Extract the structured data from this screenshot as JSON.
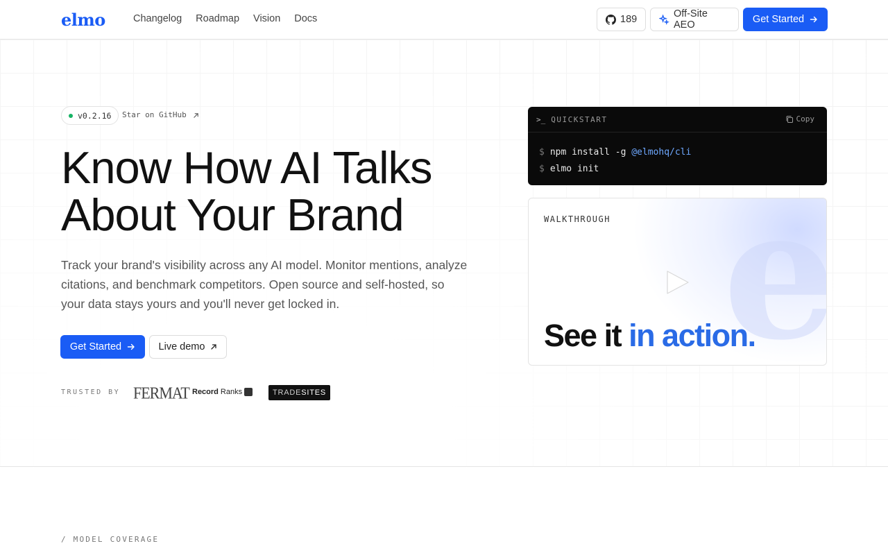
{
  "brand": {
    "logo": "elmo",
    "accent": "#1a5cf5"
  },
  "nav": {
    "items": [
      "Changelog",
      "Roadmap",
      "Vision",
      "Docs"
    ]
  },
  "header": {
    "github_count": "189",
    "github_icon": "github-icon",
    "aeo_label": "Off-Site AEO",
    "aeo_icon": "sparkle-icon",
    "cta_label": "Get Started",
    "cta_icon": "arrow-right-icon"
  },
  "hero": {
    "version": "v0.2.16",
    "star_link": "Star on GitHub",
    "title_line1": "Know How AI Talks",
    "title_line2": "About Your Brand",
    "lead": "Track your brand's visibility across any AI model. Monitor mentions, analyze citations, and benchmark competitors. Open source and self-hosted, so your data stays yours and you'll never get locked in.",
    "cta_primary": "Get Started",
    "cta_secondary": "Live demo"
  },
  "trusted": {
    "label": "TRUSTED BY",
    "logos": {
      "fermat": "FERMAT",
      "rr_bold": "Record",
      "rr_light": "Ranks",
      "trade_a": "TRADE",
      "trade_b": "SITES"
    }
  },
  "quickstart": {
    "prompt": ">_",
    "label": "QUICKSTART",
    "copy": "Copy",
    "line1_cmd": "npm install -g ",
    "line1_pkg": "@elmohq/cli",
    "line2_cmd": "elmo init",
    "dollar": "$"
  },
  "walkthrough": {
    "label": "WALKTHROUGH",
    "title_a": "See it ",
    "title_b": "in action.",
    "logo_mark": "e"
  },
  "section": {
    "label": "/ MODEL COVERAGE"
  }
}
